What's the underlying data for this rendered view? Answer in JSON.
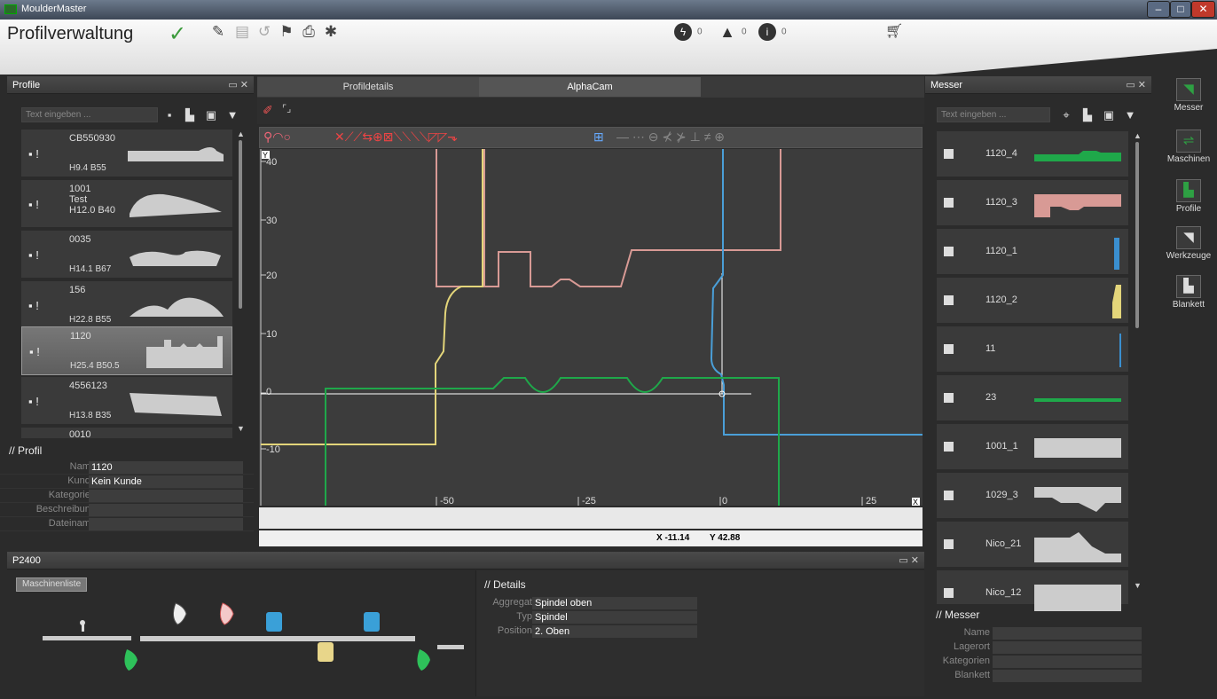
{
  "window": {
    "title": "MoulderMaster"
  },
  "header": {
    "app_name": "Profilverwaltung",
    "status": {
      "errors": "0",
      "warnings": "0",
      "info": "0"
    }
  },
  "profile_panel": {
    "title": "Profile",
    "search_placeholder": "Text eingeben ...",
    "items": [
      {
        "l1": "CB550930",
        "l2": "H9.4 B55"
      },
      {
        "l1": "1001\nTest\nH12.0 B40",
        "l2": ""
      },
      {
        "l1": "0035",
        "l2": "H14.1 B67"
      },
      {
        "l1": "156",
        "l2": "H22.8 B55"
      },
      {
        "l1": "1120",
        "l2": "H25.4 B50.5"
      },
      {
        "l1": "4556123",
        "l2": "H13.8 B35"
      },
      {
        "l1": "0010",
        "l2": ""
      }
    ],
    "detail_title": "// Profil",
    "fields": [
      {
        "k": "Name",
        "v": "1120"
      },
      {
        "k": "Kunde",
        "v": "Kein Kunde"
      },
      {
        "k": "Kategorien",
        "v": ""
      },
      {
        "k": "Beschreibung",
        "v": ""
      },
      {
        "k": "Dateiname",
        "v": ""
      }
    ]
  },
  "center": {
    "tabs": [
      "Profildetails",
      "AlphaCam"
    ],
    "axis": {
      "y": [
        "40",
        "30",
        "20",
        "10",
        "0",
        "-10"
      ],
      "x": [
        "-50",
        "-25",
        "0",
        "25"
      ],
      "y_label": "Y",
      "x_label": "X"
    },
    "coords": {
      "x": "X -11.14",
      "y": "Y 42.88"
    }
  },
  "machine_panel": {
    "title": "P2400",
    "list_button": "Maschinenliste",
    "details_title": "// Details",
    "details": [
      {
        "k": "Aggregat",
        "v": "Spindel oben"
      },
      {
        "k": "Typ",
        "v": "Spindel"
      },
      {
        "k": "Position",
        "v": "2. Oben"
      }
    ]
  },
  "messer_panel": {
    "title": "Messer",
    "search_placeholder": "Text eingeben ...",
    "items": [
      "1120_4",
      "1120_3",
      "1120_1",
      "1120_2",
      "11",
      "23",
      "1001_1",
      "1029_3",
      "Nico_21",
      "Nico_12"
    ],
    "detail_title": "// Messer",
    "fields": [
      {
        "k": "Name",
        "v": ""
      },
      {
        "k": "Lagerort",
        "v": ""
      },
      {
        "k": "Kategorien",
        "v": ""
      },
      {
        "k": "Blankett",
        "v": ""
      }
    ]
  },
  "sidebar": {
    "items": [
      "Messer",
      "Maschinen",
      "Profile",
      "Werkzeuge",
      "Blankett"
    ]
  },
  "colors": {
    "accent": "#2ea043",
    "line_red": "#d89a95",
    "line_yellow": "#e3d57a",
    "line_blue": "#4a9fd8",
    "line_green": "#1fa84a"
  }
}
